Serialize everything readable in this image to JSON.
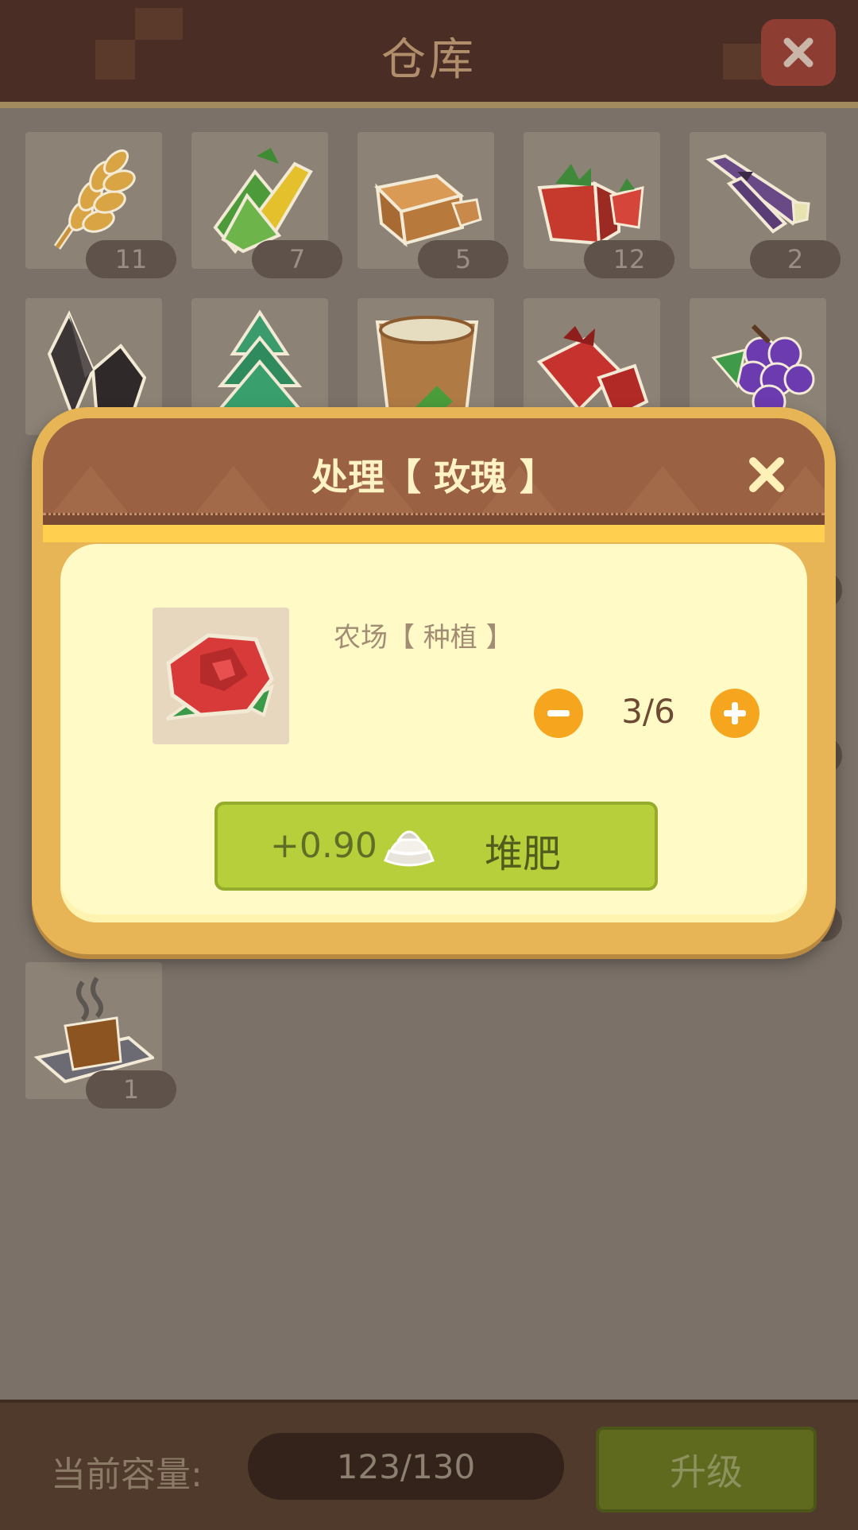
{
  "header": {
    "title": "仓库",
    "close_icon": "close-icon"
  },
  "inventory": {
    "items": [
      {
        "icon": "wheat-icon",
        "count": "11"
      },
      {
        "icon": "corn-icon",
        "count": "7"
      },
      {
        "icon": "bread-block-icon",
        "count": "5"
      },
      {
        "icon": "strawberry-icon",
        "count": "12"
      },
      {
        "icon": "eggplant-icon",
        "count": "2"
      },
      {
        "icon": "crystal-icon",
        "count": ""
      },
      {
        "icon": "pine-tree-icon",
        "count": ""
      },
      {
        "icon": "bucket-icon",
        "count": ""
      },
      {
        "icon": "pomegranate-icon",
        "count": ""
      },
      {
        "icon": "grape-icon",
        "count": ""
      },
      {
        "icon": "steaming-tray-icon",
        "count": "1"
      }
    ]
  },
  "modal": {
    "title": "处理【 玫瑰 】",
    "item_icon": "rose-icon",
    "category": "农场【 种植 】",
    "quantity": "3/6",
    "compost_amount": "+0.90",
    "compost_icon": "compost-icon",
    "compost_label": "堆肥"
  },
  "footer": {
    "capacity_label": "当前容量:",
    "capacity_value": "123/130",
    "upgrade_label": "升级"
  },
  "colors": {
    "accent_orange": "#f6a51e",
    "button_green": "#b7cf3a",
    "modal_frame": "#e7b556",
    "modal_header": "#9a6143"
  }
}
